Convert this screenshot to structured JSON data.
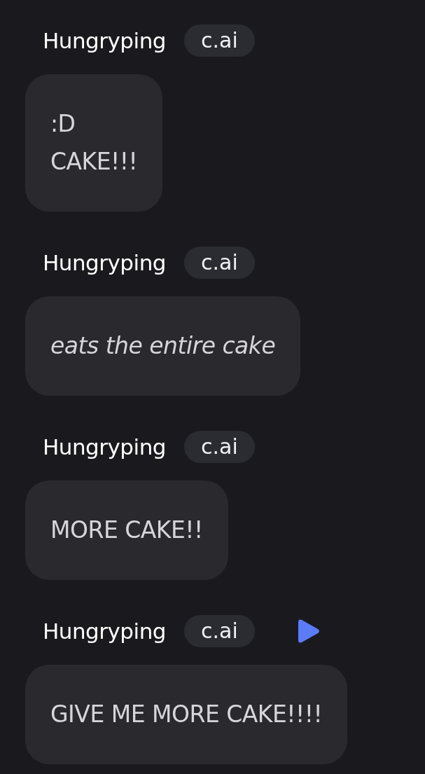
{
  "messages": [
    {
      "author": "Hungryping",
      "badge": "c.ai",
      "play": false,
      "italic": false,
      "lines": [
        ":D",
        "CAKE!!!"
      ]
    },
    {
      "author": "Hungryping",
      "badge": "c.ai",
      "play": false,
      "italic": true,
      "lines": [
        "eats the entire cake"
      ]
    },
    {
      "author": "Hungryping",
      "badge": "c.ai",
      "play": false,
      "italic": false,
      "lines": [
        "MORE CAKE!!"
      ]
    },
    {
      "author": "Hungryping",
      "badge": "c.ai",
      "play": true,
      "italic": false,
      "lines": [
        "GIVE ME MORE CAKE!!!!"
      ]
    }
  ]
}
